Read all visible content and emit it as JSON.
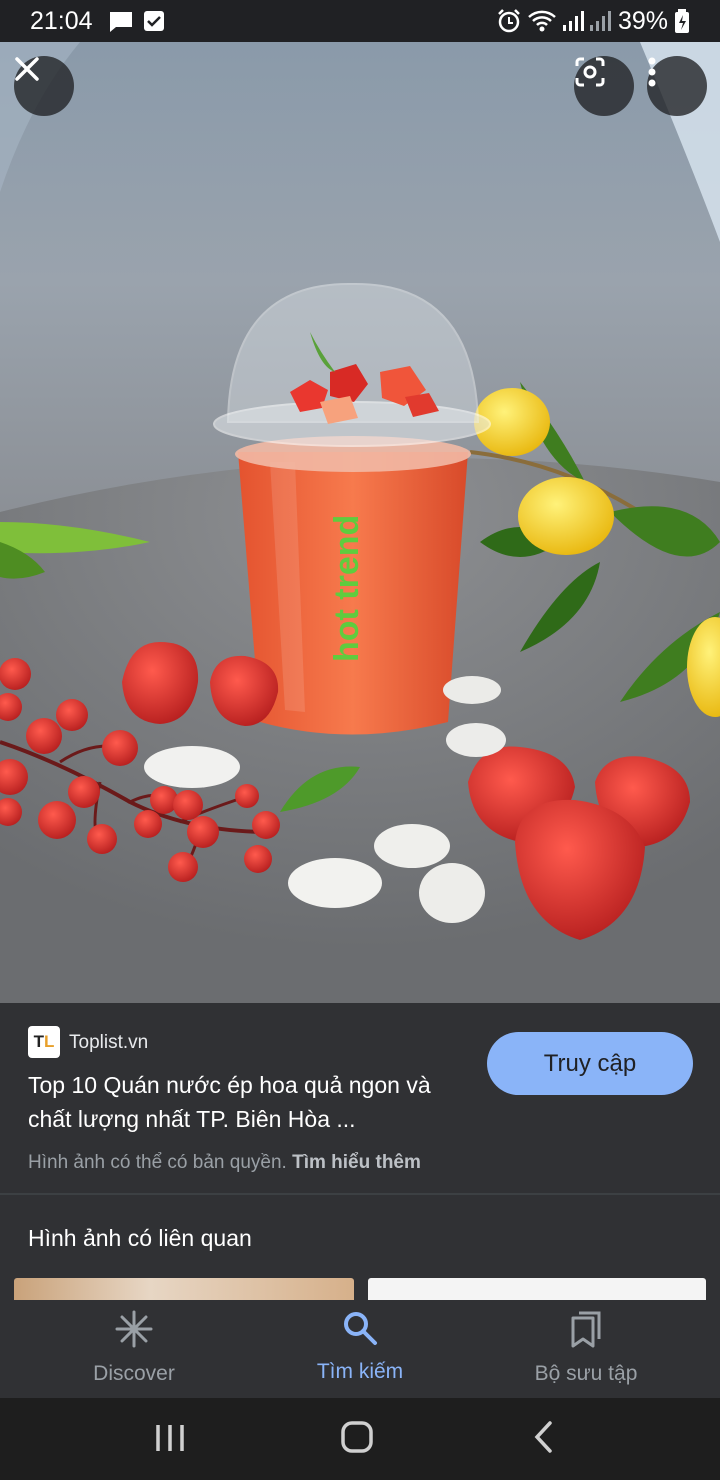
{
  "status_bar": {
    "time": "21:04",
    "battery": "39%",
    "icons": [
      "message-icon",
      "checkbox-icon",
      "alarm-icon",
      "wifi-icon",
      "signal-icon",
      "signal-icon-2",
      "battery-icon"
    ]
  },
  "viewer": {
    "cup_text": "hot trend",
    "actions": [
      "close-icon",
      "lens-icon",
      "more-icon"
    ]
  },
  "result": {
    "favicon_text": "TL",
    "source": "Toplist.vn",
    "title": "Top 10 Quán nước ép hoa quả ngon và chất lượng nhất TP. Biên Hòa ...",
    "copyright_notice": "Hình ảnh có thể có bản quyền.",
    "learn_more": "Tìm hiểu thêm",
    "visit_label": "Truy cập",
    "accent_color": "#8ab4f8"
  },
  "related": {
    "heading": "Hình ảnh có liên quan"
  },
  "bottom_nav": {
    "items": [
      {
        "label": "Discover",
        "icon": "asterisk-icon"
      },
      {
        "label": "Tìm kiếm",
        "icon": "search-icon",
        "active": true
      },
      {
        "label": "Bộ sưu tập",
        "icon": "collections-icon"
      }
    ]
  },
  "system_nav": [
    "recents-icon",
    "home-icon",
    "back-icon"
  ]
}
